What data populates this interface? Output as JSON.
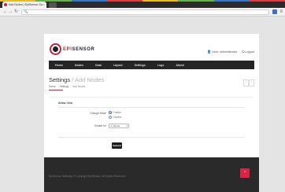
{
  "browser": {
    "tab_title": "Add Nodes | EpiSensor Ga...",
    "tab_close": "×",
    "back": "←",
    "forward": "→",
    "reload": "↻",
    "search_glyph": "🔍",
    "menu_glyph": "≡",
    "rainbow_colors": [
      "#e8b933",
      "#6ab04c",
      "#3a75c4",
      "#d64045",
      "#e8b933",
      "#6ab04c",
      "#3a75c4",
      "#d64045"
    ]
  },
  "brand": {
    "accent": "#c4223c",
    "epi": "EPI",
    "sensor": "SENSOR"
  },
  "user": {
    "icon": "👤",
    "label": "User: administrator",
    "logout_icon": "⏻",
    "logout": "Logout"
  },
  "nav": {
    "items": [
      "Home",
      "Nodes",
      "Data",
      "Layout",
      "Settings",
      "Logs",
      "About"
    ]
  },
  "page": {
    "title": "Settings",
    "title_sub": "/ Add Nodes",
    "breadcrumb": [
      "Home",
      "Settings",
      "Add Nodes"
    ],
    "breadcrumb_sep": "/",
    "pager_prev": "‹",
    "pager_next": "›"
  },
  "form": {
    "section_title": "Allow Join",
    "change_mode_label": "Change Mode",
    "option_enable": "Enable",
    "option_disable": "Disable",
    "enable_for_label": "Enable for",
    "enable_for_value": "1 minute",
    "select_chevron": "▾",
    "submit": "Submit"
  },
  "footer": {
    "text": "EpiSensor Gateway © Copyright EpiSensor. All Rights Reserved.",
    "back_to_top": "^"
  }
}
